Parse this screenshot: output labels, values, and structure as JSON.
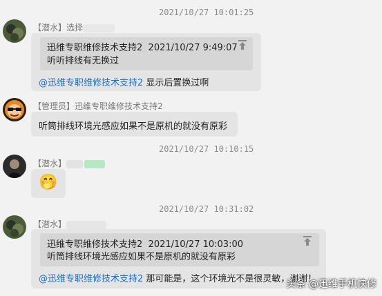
{
  "timestamps": [
    "2021/10/27 10:01:25",
    "2021/10/27 10:10:15",
    "2021/10/27 10:31:02"
  ],
  "messages": [
    {
      "sender": "【潜水】选择",
      "quote": {
        "author": "迅维专职维修技术支持2",
        "time": "2021/10/27 9:49:07",
        "text": "听听排线有无换过"
      },
      "mention": "@迅维专职维修技术支持2",
      "text": "显示后置换过啊"
    },
    {
      "sender": "【管理员】迅维专职维修技术支持2",
      "text": "听筒排线环境光感应如果不是原机的就没有原彩"
    },
    {
      "sender": "【潜水】",
      "emoji": "🤭"
    },
    {
      "sender": "【潜水】",
      "quote": {
        "author": "迅维专职维修技术支持2",
        "time": "2021/10/27 10:03:00",
        "text": "听筒排线环境光感应如果不是原机的就没有原彩"
      },
      "mention": "@迅维专职维修技术支持2",
      "text": "那可能是，这个环境光不是很灵敏，谢谢！"
    }
  ],
  "watermark": "头条 @迅维手机快修",
  "colors": {
    "mention": "#1a6fd0",
    "bubble": "#e4e4e4",
    "quote": "#d6d6d6",
    "timestamp": "#8a8a8a"
  },
  "icons": [
    "pin-to-top-icon"
  ]
}
